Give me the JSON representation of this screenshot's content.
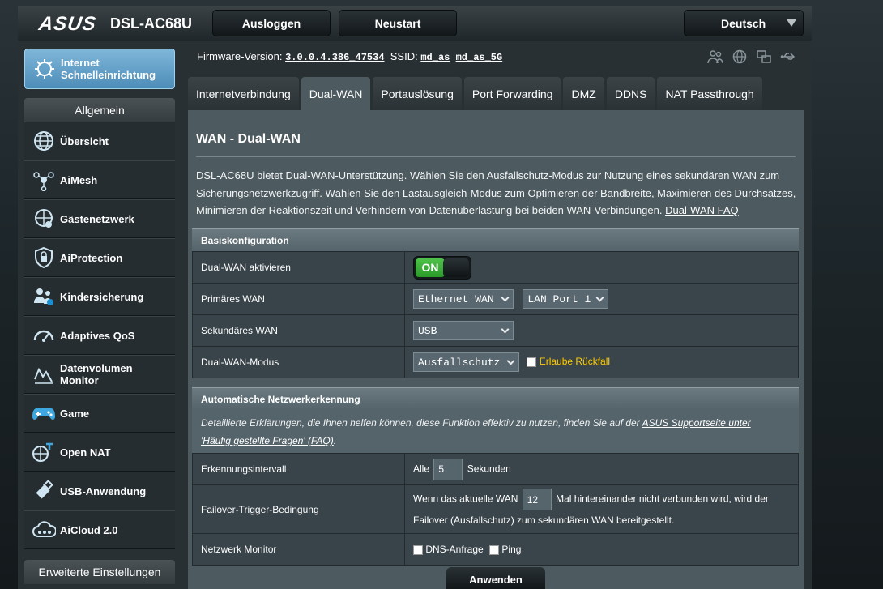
{
  "header": {
    "brand": "ASUS",
    "model": "DSL-AC68U",
    "logout_label": "Ausloggen",
    "restart_label": "Neustart",
    "language": "Deutsch"
  },
  "info": {
    "firmware_label": "Firmware-Version:",
    "firmware_value": "3.0.0.4.386_47534",
    "ssid_label": "SSID:",
    "ssid_1": "md_as",
    "ssid_2": "md_as_5G"
  },
  "sidebar": {
    "quick_setup_line1": "Internet",
    "quick_setup_line2": "Schnelleinrichtung",
    "general_header": "Allgemein",
    "items": [
      {
        "label": "Übersicht",
        "icon": "globe-icon"
      },
      {
        "label": "AiMesh",
        "icon": "mesh-icon"
      },
      {
        "label": "Gästenetzwerk",
        "icon": "guest-network-icon"
      },
      {
        "label": "AiProtection",
        "icon": "lock-icon"
      },
      {
        "label": "Kindersicherung",
        "icon": "parental-icon"
      },
      {
        "label": "Adaptives QoS",
        "icon": "gauge-icon"
      },
      {
        "label": "Datenvolumen",
        "label2": "Monitor",
        "icon": "traffic-icon"
      },
      {
        "label": "Game",
        "icon": "gamepad-icon"
      },
      {
        "label": "Open NAT",
        "icon": "open-nat-icon"
      },
      {
        "label": "USB-Anwendung",
        "icon": "usb-icon"
      },
      {
        "label": "AiCloud 2.0",
        "icon": "cloud-icon"
      }
    ],
    "advanced_header": "Erweiterte Einstellungen"
  },
  "tabs": [
    {
      "label": "Internetverbindung",
      "active": false
    },
    {
      "label": "Dual-WAN",
      "active": true
    },
    {
      "label": "Portauslösung",
      "active": false
    },
    {
      "label": "Port Forwarding",
      "active": false
    },
    {
      "label": "DMZ",
      "active": false
    },
    {
      "label": "DDNS",
      "active": false
    },
    {
      "label": "NAT Passthrough",
      "active": false
    }
  ],
  "main": {
    "title": "WAN - Dual-WAN",
    "description": "DSL-AC68U bietet Dual-WAN-Unterstützung. Wählen Sie den Ausfallschutz-Modus zur Nutzung eines sekundären WAN zum Sicherungsnetzwerkzugriff. Wählen Sie den Lastausgleich-Modus zum Optimieren der Bandbreite, Maximieren des Durchsatzes, Minimieren der Reaktionszeit und Verhindern von Datenüberlastung bei beiden WAN-Verbindungen. ",
    "faq_link": "Dual-WAN FAQ",
    "basic": {
      "header": "Basiskonfiguration",
      "enable_label": "Dual-WAN aktivieren",
      "enable_state": "ON",
      "primary_label": "Primäres WAN",
      "primary_value": "Ethernet WAN",
      "primary_port": "LAN Port 1",
      "secondary_label": "Sekundäres WAN",
      "secondary_value": "USB",
      "mode_label": "Dual-WAN-Modus",
      "mode_value": "Ausfallschutz",
      "fallback_label": "Erlaube Rückfall"
    },
    "detect": {
      "header": "Automatische Netzwerkerkennung",
      "note": "Detaillierte Erklärungen, die Ihnen helfen können, diese Funktion effektiv zu nutzen, finden Sie auf der ",
      "note_link1": "ASUS Supportseite unter",
      "note_link2": "'Häufig gestellte Fragen' (FAQ)",
      "note_end": ".",
      "interval_label": "Erkennungsintervall",
      "interval_prefix": "Alle",
      "interval_value": "5",
      "interval_suffix": "Sekunden",
      "failover_label": "Failover-Trigger-Bedingung",
      "failover_prefix": "Wenn das aktuelle WAN",
      "failover_value": "12",
      "failover_suffix": "Mal hintereinander nicht verbunden wird, wird der",
      "failover_line2": "Failover (Ausfallschutz) zum sekundären WAN bereitgestellt.",
      "monitor_label": "Netzwerk Monitor",
      "dns_label": "DNS-Anfrage",
      "ping_label": "Ping"
    },
    "apply_label": "Anwenden"
  }
}
